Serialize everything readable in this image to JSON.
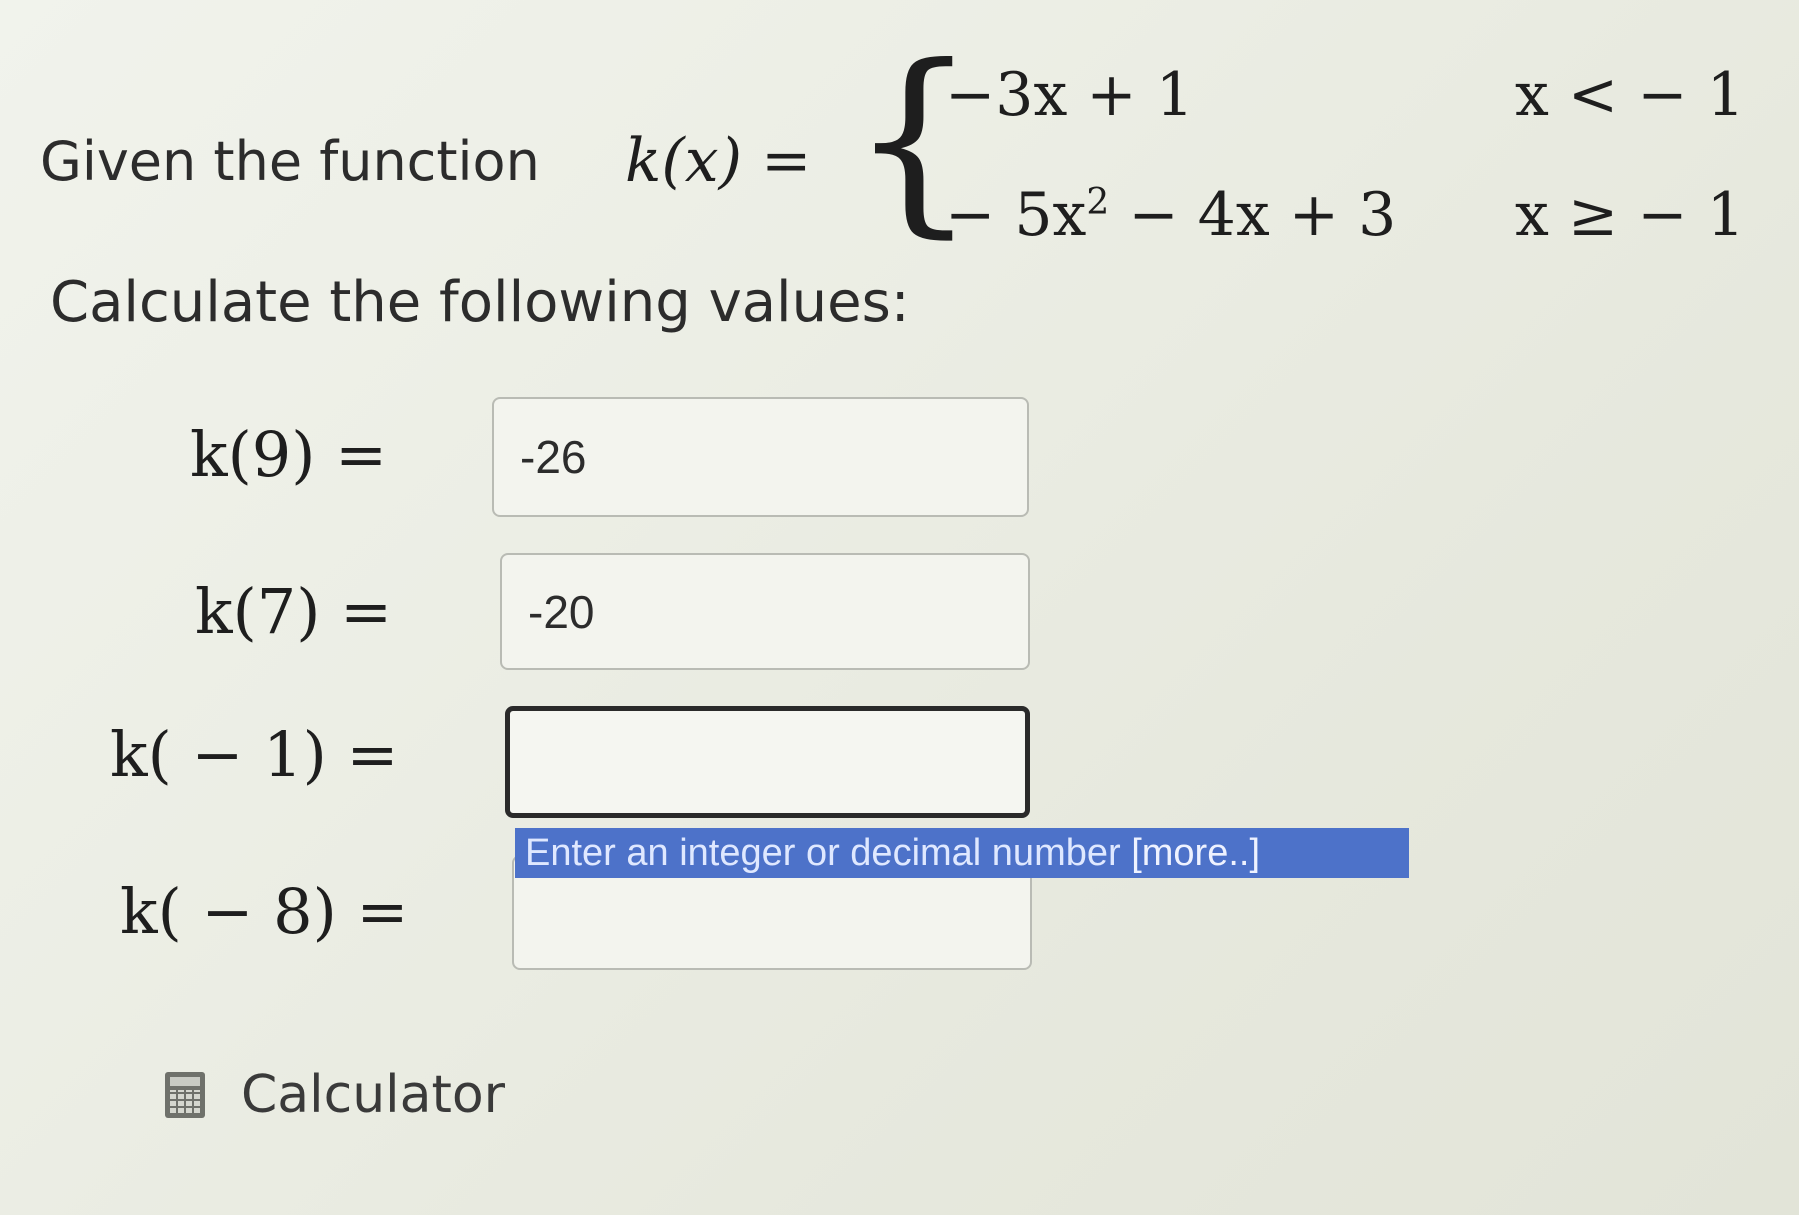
{
  "problem": {
    "prompt": "Given the function",
    "function_lhs": "k(x) =",
    "cases": [
      {
        "expression": "−3x + 1",
        "condition": "x < − 1"
      },
      {
        "expression_main": "− 5x",
        "expression_exp": "2",
        "expression_rest": " − 4x + 3",
        "condition": "x ≥ − 1"
      }
    ],
    "instruction": "Calculate the following values:"
  },
  "answers": [
    {
      "label": "k(9) =",
      "value": "-26"
    },
    {
      "label": "k(7) =",
      "value": "-20"
    },
    {
      "label": "k( − 1) =",
      "value": ""
    },
    {
      "label": "k( − 8) =",
      "value": ""
    }
  ],
  "tooltip": {
    "text": "Enter an integer or decimal number ",
    "more": "[more..]"
  },
  "calculator": {
    "label": "Calculator",
    "icon": "calculator-icon"
  }
}
